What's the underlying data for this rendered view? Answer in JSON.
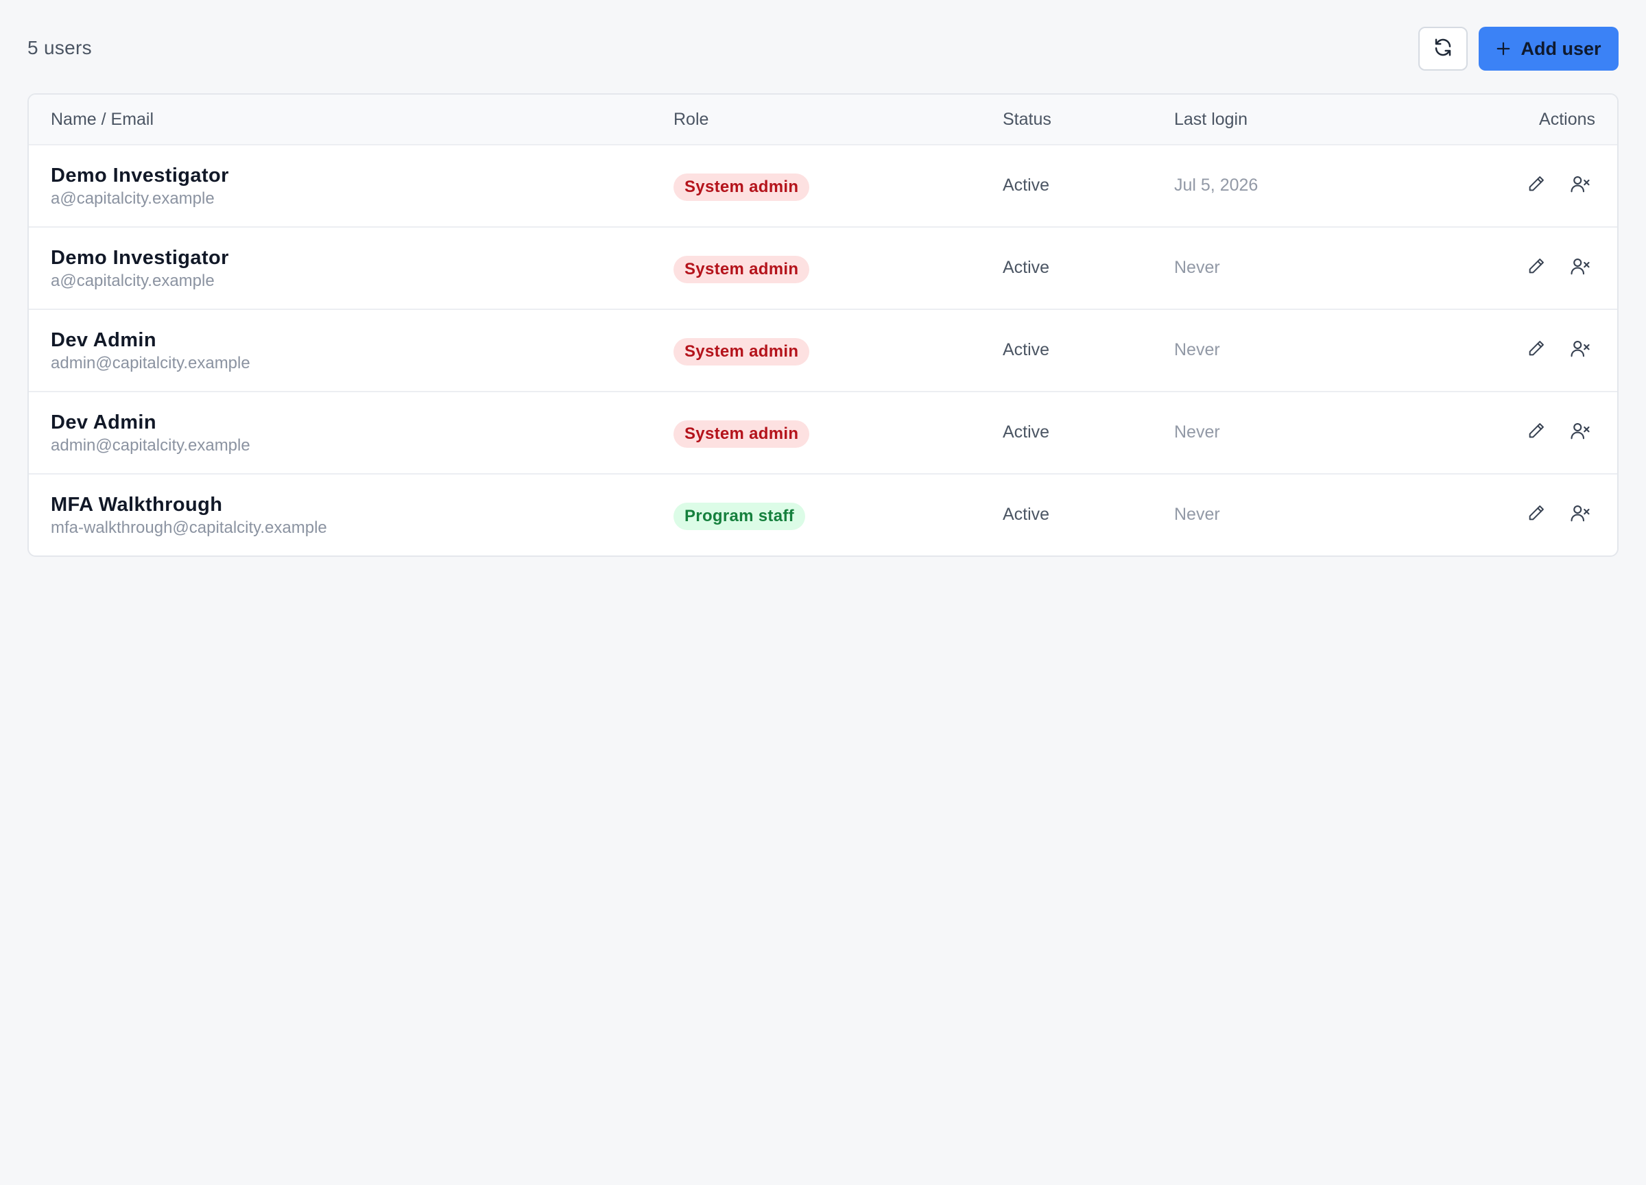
{
  "header": {
    "user_count": "5 users",
    "refresh_icon": "refresh-icon",
    "add_user_label": "Add user",
    "add_icon": "plus-icon"
  },
  "colors": {
    "primary": "#3b82f6",
    "admin_badge_bg": "#fde1e1",
    "admin_badge_text": "#b4131b",
    "staff_badge_bg": "#dcfce7",
    "staff_badge_text": "#15803d"
  },
  "table": {
    "columns": {
      "name": "Name / Email",
      "role": "Role",
      "status": "Status",
      "last_login": "Last login",
      "actions": "Actions"
    },
    "rows": [
      {
        "name": "Demo Investigator",
        "email": "a@capitalcity.example",
        "role": "System admin",
        "role_kind": "admin",
        "status": "Active",
        "last_login": "Jul 5, 2026"
      },
      {
        "name": "Demo Investigator",
        "email": "a@capitalcity.example",
        "role": "System admin",
        "role_kind": "admin",
        "status": "Active",
        "last_login": "Never"
      },
      {
        "name": "Dev Admin",
        "email": "admin@capitalcity.example",
        "role": "System admin",
        "role_kind": "admin",
        "status": "Active",
        "last_login": "Never"
      },
      {
        "name": "Dev Admin",
        "email": "admin@capitalcity.example",
        "role": "System admin",
        "role_kind": "admin",
        "status": "Active",
        "last_login": "Never"
      },
      {
        "name": "MFA Walkthrough",
        "email": "mfa-walkthrough@capitalcity.example",
        "role": "Program staff",
        "role_kind": "staff",
        "status": "Active",
        "last_login": "Never"
      }
    ],
    "row_actions": {
      "edit_icon": "pencil-icon",
      "deactivate_icon": "user-remove-icon"
    }
  }
}
